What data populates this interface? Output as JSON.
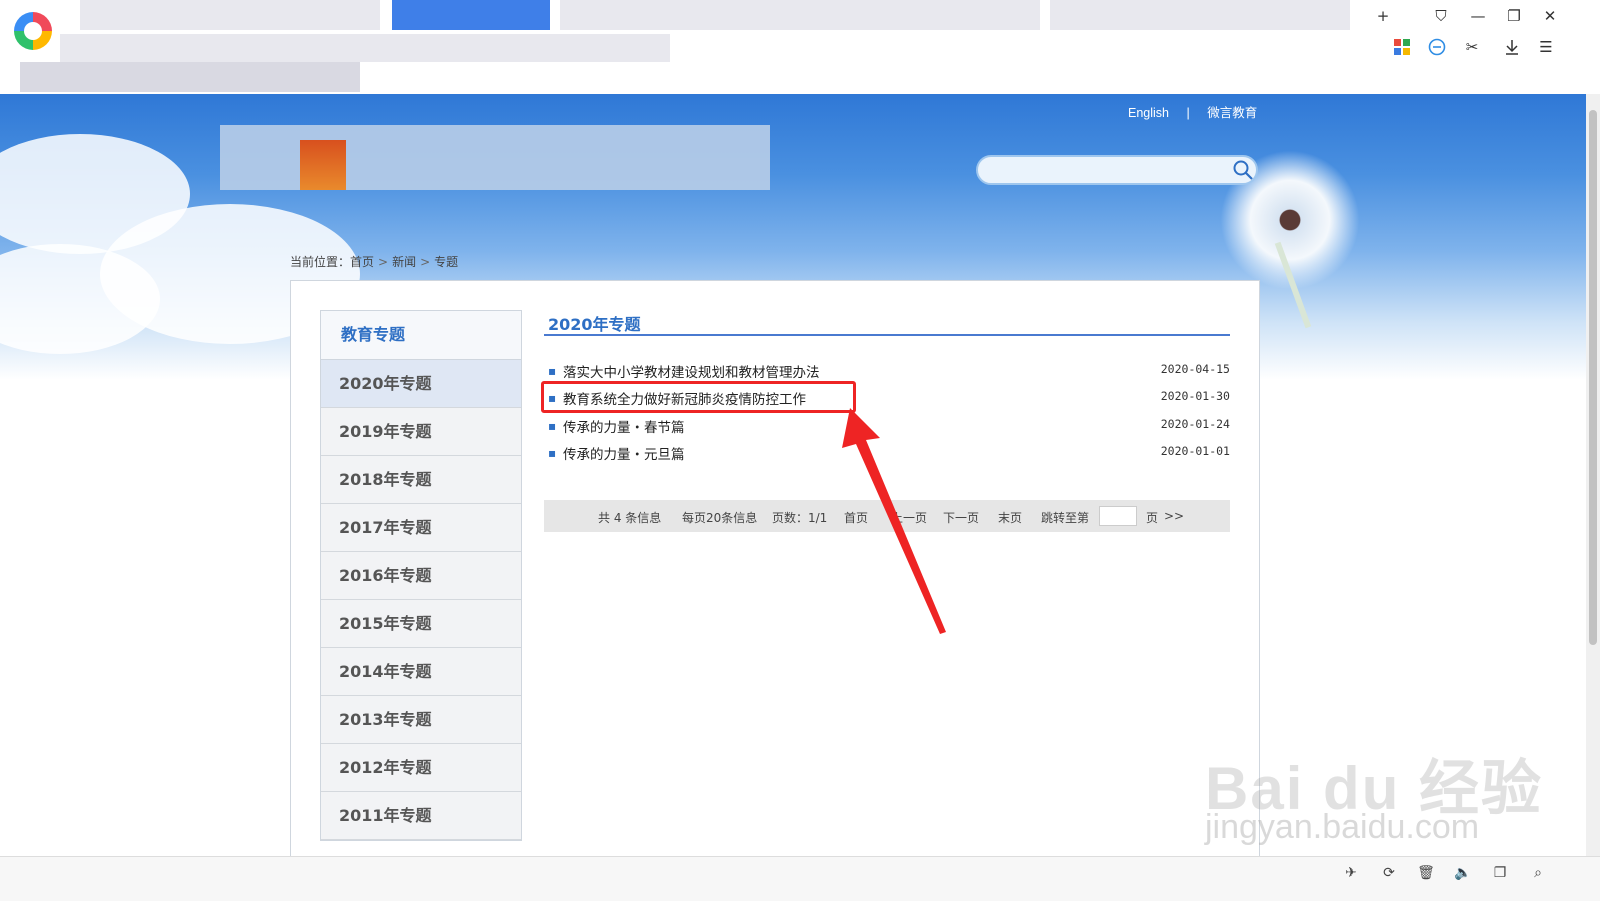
{
  "browser": {
    "window_controls": [
      "+",
      "⛉",
      "—",
      "❐",
      "✕"
    ],
    "toolbar_icons": [
      "apps-icon",
      "speed-icon",
      "scissors-icon",
      "download-icon",
      "menu-icon"
    ]
  },
  "header": {
    "lang_english": "English",
    "lang_separator": "|",
    "lang_weibo": "微言教育",
    "search_placeholder": ""
  },
  "breadcrumb": {
    "prefix": "当前位置：",
    "home": "首页",
    "news": "新闻",
    "topic": "专题",
    "sep": ">"
  },
  "sidebar": {
    "title": "教育专题",
    "items": [
      {
        "label": "2020年专题",
        "active": true
      },
      {
        "label": "2019年专题"
      },
      {
        "label": "2018年专题"
      },
      {
        "label": "2017年专题"
      },
      {
        "label": "2016年专题"
      },
      {
        "label": "2015年专题"
      },
      {
        "label": "2014年专题"
      },
      {
        "label": "2013年专题"
      },
      {
        "label": "2012年专题"
      },
      {
        "label": "2011年专题"
      }
    ]
  },
  "main": {
    "section_title": "2020年专题",
    "bullet": "▪",
    "news": [
      {
        "title": "落实大中小学教材建设规划和教材管理办法",
        "date": "2020-04-15"
      },
      {
        "title": "教育系统全力做好新冠肺炎疫情防控工作",
        "date": "2020-01-30"
      },
      {
        "title": "传承的力量・春节篇",
        "date": "2020-01-24"
      },
      {
        "title": "传承的力量・元旦篇",
        "date": "2020-01-01"
      }
    ],
    "pager": {
      "total": "共 4 条信息",
      "per_page": "每页20条信息",
      "pages": "页数：1/1",
      "first": "首页",
      "prev": "上一页",
      "next": "下一页",
      "last": "末页",
      "jump": "跳转至第",
      "page_suffix": "页",
      "go": ">>"
    }
  },
  "watermark": {
    "line1": "Bai du 经验",
    "line2": "jingyan.baidu.com"
  },
  "colors": {
    "accent": "#2e6fc4",
    "highlight": "#ee2424"
  }
}
